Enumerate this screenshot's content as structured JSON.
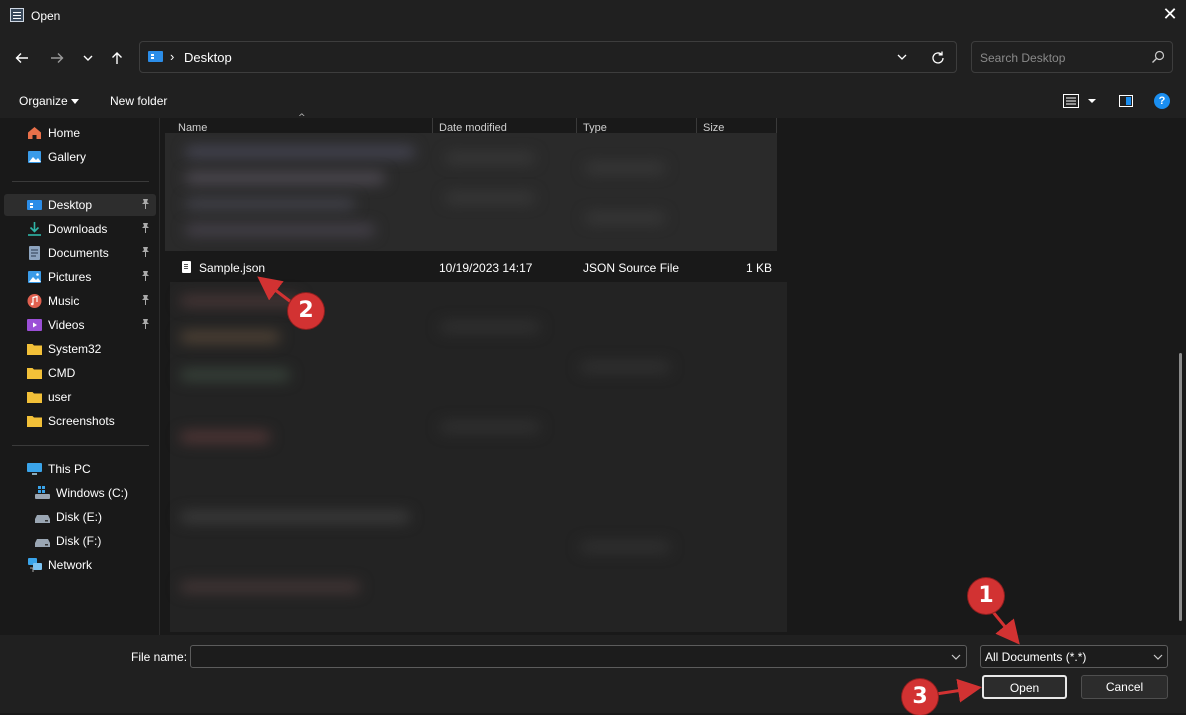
{
  "window": {
    "title": "Open",
    "close_glyph": "✕"
  },
  "address": {
    "path_segment": "Desktop",
    "separator": "›"
  },
  "search": {
    "placeholder": "Search Desktop"
  },
  "command_bar": {
    "organize": "Organize",
    "new_folder": "New folder",
    "help": "?"
  },
  "sidebar": {
    "quick": [
      {
        "label": "Home",
        "icon": "home-icon"
      },
      {
        "label": "Gallery",
        "icon": "gallery-icon"
      }
    ],
    "pinned": [
      {
        "label": "Desktop",
        "icon": "desktop-icon",
        "selected": true
      },
      {
        "label": "Downloads",
        "icon": "downloads-icon"
      },
      {
        "label": "Documents",
        "icon": "documents-icon"
      },
      {
        "label": "Pictures",
        "icon": "pictures-icon"
      },
      {
        "label": "Music",
        "icon": "music-icon"
      },
      {
        "label": "Videos",
        "icon": "videos-icon"
      }
    ],
    "folders": [
      {
        "label": "System32",
        "icon": "folder-icon"
      },
      {
        "label": "CMD",
        "icon": "folder-icon"
      },
      {
        "label": "user",
        "icon": "folder-icon"
      },
      {
        "label": "Screenshots",
        "icon": "folder-icon"
      }
    ],
    "this_pc": {
      "label": "This PC",
      "icon": "this-pc-icon"
    },
    "drives": [
      {
        "label": "Windows (C:)",
        "icon": "windows-drive-icon"
      },
      {
        "label": "Disk (E:)",
        "icon": "disk-drive-icon"
      },
      {
        "label": "Disk (F:)",
        "icon": "disk-drive-icon"
      }
    ],
    "network": {
      "label": "Network",
      "icon": "network-icon"
    }
  },
  "file_list": {
    "columns": {
      "name": "Name",
      "date": "Date modified",
      "type": "Type",
      "size": "Size"
    },
    "sort_glyph": "^",
    "visible_row": {
      "name": "Sample.json",
      "date": "10/19/2023 14:17",
      "type": "JSON Source File",
      "size": "1 KB"
    }
  },
  "bottom": {
    "file_name_label": "File name:",
    "file_name_value": "",
    "file_type": "All Documents (*.*)",
    "open_button": "Open",
    "cancel_button": "Cancel"
  },
  "annotations": [
    "1",
    "2",
    "3"
  ],
  "colors": {
    "accent": "#1a8ef0",
    "annotation": "#d23232",
    "background": "#191919"
  }
}
